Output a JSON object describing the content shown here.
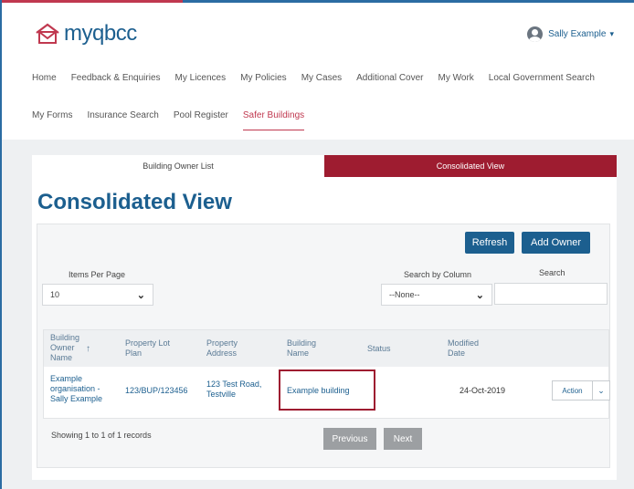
{
  "header": {
    "logo_text": "myqbcc",
    "user_name": "Sally Example"
  },
  "nav": {
    "row1": [
      "Home",
      "Feedback & Enquiries",
      "My Licences",
      "My Policies",
      "My Cases",
      "Additional Cover",
      "My Work",
      "Local Government Search"
    ],
    "row2": [
      "My Forms",
      "Insurance Search",
      "Pool Register",
      "Safer Buildings"
    ],
    "active": "Safer Buildings"
  },
  "tabs": {
    "list": "Building Owner List",
    "consolidated": "Consolidated View"
  },
  "page_title": "Consolidated View",
  "toolbar": {
    "refresh": "Refresh",
    "add_owner": "Add Owner"
  },
  "filters": {
    "items_per_page_label": "Items Per Page",
    "items_per_page_value": "10",
    "search_by_column_label": "Search by Column",
    "search_by_column_value": "--None--",
    "search_label": "Search",
    "search_value": ""
  },
  "table": {
    "headers": {
      "owner_line1": "Building",
      "owner_line2": "Owner",
      "owner_line3": "Name",
      "sort_arrow": "↑",
      "lot_line1": "Property Lot",
      "lot_line2": "Plan",
      "addr_line1": "Property",
      "addr_line2": "Address",
      "bname_line1": "Building",
      "bname_line2": "Name",
      "status": "Status",
      "modified_line1": "Modified",
      "modified_line2": "Date"
    },
    "row": {
      "owner_line1": "Example",
      "owner_line2": "organisation -",
      "owner_line3": "Sally Example",
      "lot_plan": "123/BUP/123456",
      "address_line1": "123 Test Road,",
      "address_line2": "Testville",
      "building_name": "Example building",
      "status": "",
      "modified": "24-Oct-2019",
      "action": "Action"
    }
  },
  "footer": {
    "showing": "Showing 1 to 1 of 1 records",
    "previous": "Previous",
    "next": "Next"
  },
  "colors": {
    "brand_blue": "#1c5f8f",
    "accent_red": "#9e1c30"
  }
}
